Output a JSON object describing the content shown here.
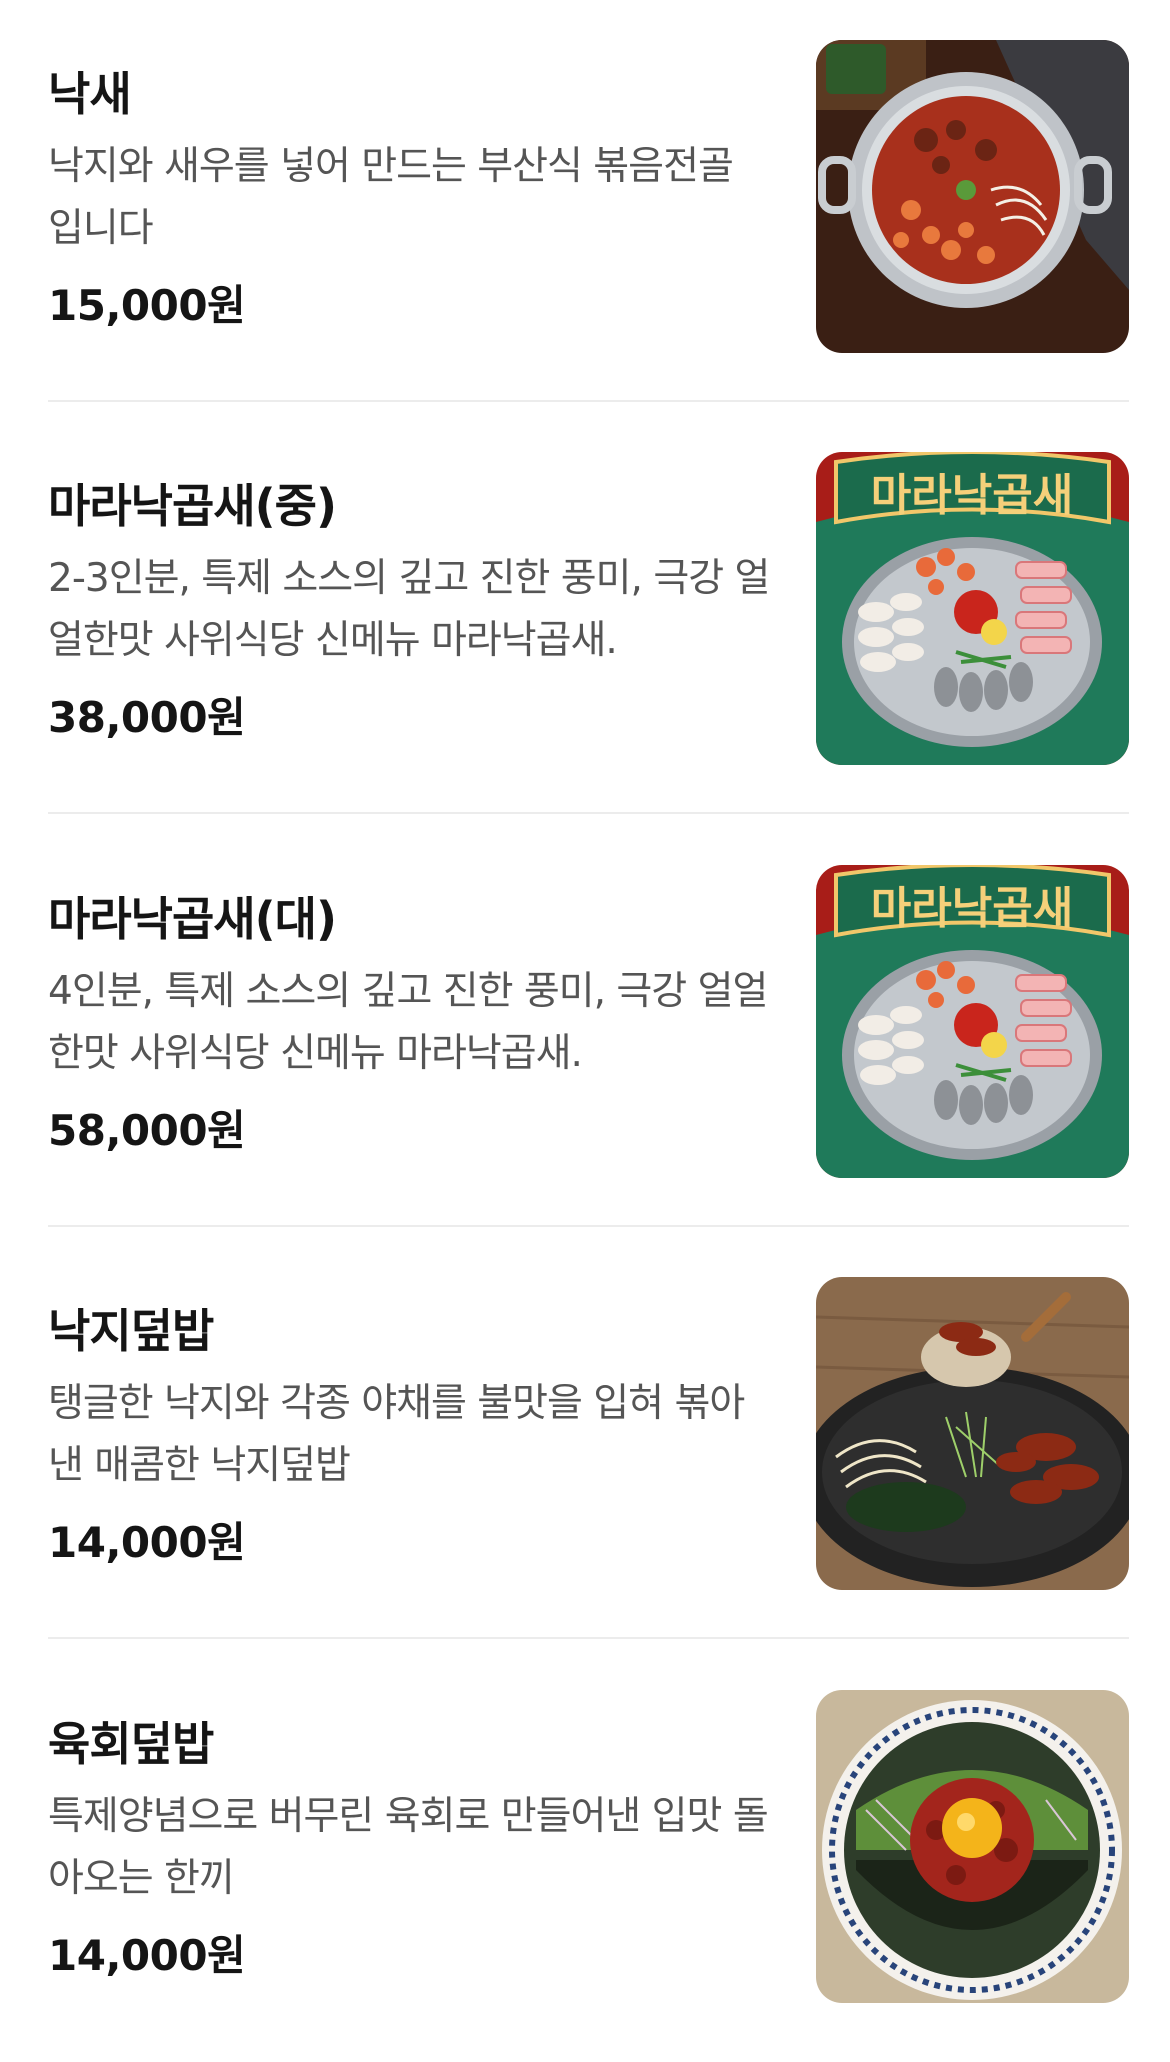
{
  "menu": {
    "items": [
      {
        "name": "낙새",
        "description": "낙지와 새우를 넣어 만드는 부산식 볶음전골 입니다",
        "price": "15,000원",
        "image_icon": "nakssae-hotpot-photo"
      },
      {
        "name": "마라낙곱새(중)",
        "description": "2-3인분, 특제 소스의 깊고 진한 풍미, 극강 얼얼한맛 사위식당 신메뉴 마라낙곱새.",
        "price": "38,000원",
        "image_icon": "mala-nakgopsae-poster-photo",
        "image_label": "마라낙곱새"
      },
      {
        "name": "마라낙곱새(대)",
        "description": "4인분, 특제 소스의 깊고 진한 풍미, 극강 얼얼한맛 사위식당 신메뉴 마라낙곱새.",
        "price": "58,000원",
        "image_icon": "mala-nakgopsae-poster-photo",
        "image_label": "마라낙곱새"
      },
      {
        "name": "낙지덮밥",
        "description": "탱글한 낙지와 각종 야채를 불맛을 입혀 볶아낸 매콤한 낙지덮밥",
        "price": "14,000원",
        "image_icon": "octopus-rice-bowl-photo"
      },
      {
        "name": "육회덮밥",
        "description": "특제양념으로 버무린 육회로 만들어낸 입맛 돌아오는 한끼",
        "price": "14,000원",
        "image_icon": "yukhoe-rice-bowl-photo"
      }
    ]
  },
  "colors": {
    "text_primary": "#151515",
    "text_secondary": "#555555",
    "divider": "#ececec",
    "background": "#ffffff"
  }
}
